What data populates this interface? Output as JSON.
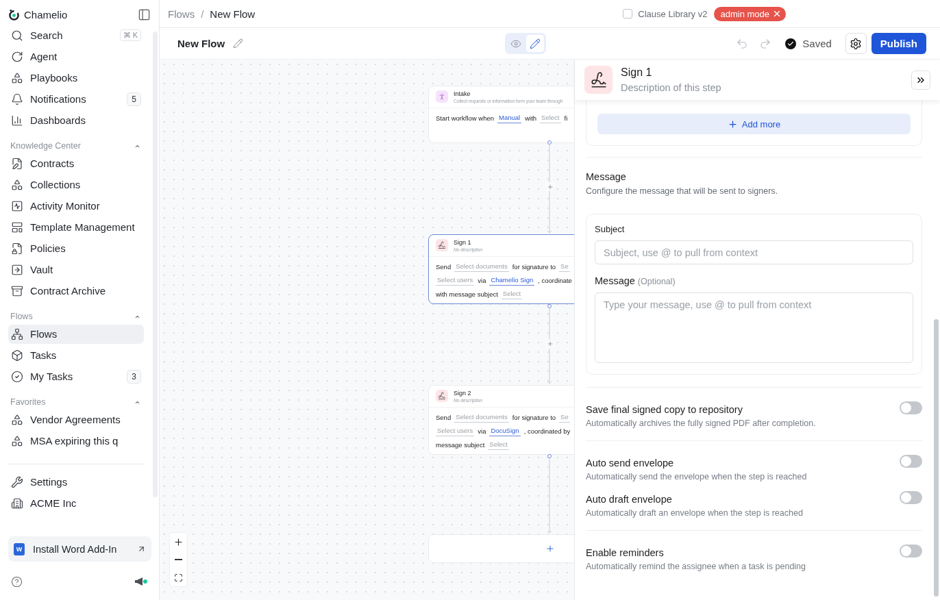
{
  "sidebar": {
    "brand": "Chamelio",
    "top_items": [
      {
        "label": "Search",
        "shortcut": "⌘ K",
        "selected": false
      },
      {
        "label": "Agent",
        "selected": false
      },
      {
        "label": "Playbooks",
        "selected": false
      },
      {
        "label": "Notifications",
        "count": "5",
        "selected": false
      },
      {
        "label": "Dashboards",
        "selected": false
      }
    ],
    "sections": [
      {
        "title": "Knowledge Center",
        "expanded": true,
        "items": [
          {
            "label": "Contracts",
            "selected": false
          },
          {
            "label": "Collections",
            "selected": false
          },
          {
            "label": "Activity Monitor",
            "selected": false
          },
          {
            "label": "Template Management",
            "selected": false
          },
          {
            "label": "Policies",
            "selected": false
          },
          {
            "label": "Vault",
            "selected": false
          },
          {
            "label": "Contract Archive",
            "selected": false
          }
        ]
      },
      {
        "title": "Flows",
        "expanded": true,
        "items": [
          {
            "label": "Flows",
            "selected": true
          },
          {
            "label": "Tasks",
            "selected": false
          },
          {
            "label": "My Tasks",
            "count": "3",
            "selected": false
          }
        ]
      },
      {
        "title": "Favorites",
        "expanded": true,
        "items": [
          {
            "label": "Vendor Agreements",
            "selected": false
          },
          {
            "label": "MSA expiring this q",
            "selected": false
          }
        ]
      }
    ],
    "bottom_items": [
      {
        "label": "Settings",
        "selected": false
      },
      {
        "label": "ACME Inc",
        "selected": false
      }
    ],
    "addin": {
      "label": "Install Word Add-In",
      "badge": "W"
    }
  },
  "topbar": {
    "breadcrumb": [
      "Flows",
      "New Flow"
    ],
    "separator": "/",
    "option": {
      "label": "Clause Library v2",
      "checked": false
    },
    "badge": "admin mode"
  },
  "toolbar": {
    "title": "New Flow",
    "modes": [
      {
        "kind": "view",
        "selected": false
      },
      {
        "kind": "edit",
        "selected": true
      }
    ],
    "undo_disabled": true,
    "redo_disabled": true,
    "status": "Saved",
    "publish": "Publish"
  },
  "canvas": {
    "nodes": [
      {
        "kind": "intake",
        "title": "Intake",
        "description": "Collect requests or information form your team through",
        "selected": false,
        "lines": [
          [
            {
              "kind": "text",
              "text": "Start workflow when"
            },
            {
              "kind": "value",
              "text": "Manual"
            },
            {
              "kind": "text",
              "text": "with"
            },
            {
              "kind": "placeholder",
              "text": "Select"
            },
            {
              "kind": "text",
              "text": "fi"
            }
          ]
        ]
      },
      {
        "kind": "sign",
        "title": "Sign 1",
        "description": "No description",
        "selected": true,
        "lines": [
          [
            {
              "kind": "text",
              "text": "Send"
            },
            {
              "kind": "placeholder",
              "text": "Select documents"
            },
            {
              "kind": "text",
              "text": "for signature to"
            },
            {
              "kind": "placeholder",
              "text": "Se"
            }
          ],
          [
            {
              "kind": "placeholder",
              "text": "Select users"
            },
            {
              "kind": "text",
              "text": "via"
            },
            {
              "kind": "value",
              "text": "Chamelio Sign"
            },
            {
              "kind": "text",
              "text": ", coordinate"
            }
          ],
          [
            {
              "kind": "text",
              "text": "with message subject"
            },
            {
              "kind": "placeholder",
              "text": "Select"
            }
          ]
        ]
      },
      {
        "kind": "sign",
        "title": "Sign 2",
        "description": "No description",
        "selected": false,
        "lines": [
          [
            {
              "kind": "text",
              "text": "Send"
            },
            {
              "kind": "placeholder",
              "text": "Select documents"
            },
            {
              "kind": "text",
              "text": "for signature to"
            },
            {
              "kind": "placeholder",
              "text": "Se"
            }
          ],
          [
            {
              "kind": "placeholder",
              "text": "Select users"
            },
            {
              "kind": "text",
              "text": "via"
            },
            {
              "kind": "value",
              "text": "DocuSign"
            },
            {
              "kind": "text",
              "text": ", coordinated by"
            }
          ],
          [
            {
              "kind": "text",
              "text": "message subject"
            },
            {
              "kind": "placeholder",
              "text": "Select"
            }
          ]
        ]
      },
      {
        "kind": "add",
        "selected": false
      }
    ]
  },
  "panel": {
    "title": "Sign 1",
    "description_placeholder": "Description of this step",
    "add_more": "Add more",
    "message": {
      "title": "Message",
      "description": "Configure the message that will be sent to signers.",
      "subject_label": "Subject",
      "subject_placeholder": "Subject, use @ to pull from context",
      "message_label": "Message",
      "message_hint": "(Optional)",
      "message_placeholder": "Type your message, use @ to pull from context"
    },
    "toggles": [
      {
        "label": "Save final signed copy to repository",
        "description": "Automatically archives the fully signed PDF after completion.",
        "on": false
      },
      {
        "label": "Auto send envelope",
        "description": "Automatically send the envelope when the step is reached",
        "on": false
      },
      {
        "label": "Auto draft envelope",
        "description": "Automatically draft an envelope when the step is reached",
        "on": false
      },
      {
        "label": "Enable reminders",
        "description": "Automatically remind the assignee when a task is pending",
        "on": false
      }
    ]
  }
}
